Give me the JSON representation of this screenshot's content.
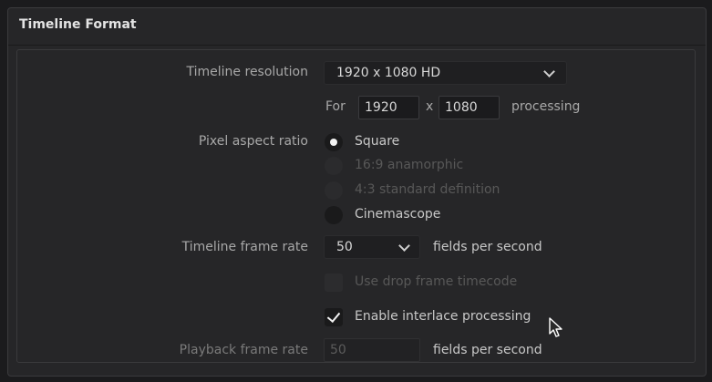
{
  "panel": {
    "title": "Timeline Format"
  },
  "resolution": {
    "label": "Timeline resolution",
    "selected": "1920 x 1080 HD",
    "for_label": "For",
    "width": "1920",
    "times": "x",
    "height": "1080",
    "processing_label": "processing"
  },
  "pixel_aspect": {
    "label": "Pixel aspect ratio",
    "options": [
      {
        "label": "Square",
        "state": "selected"
      },
      {
        "label": "16:9 anamorphic",
        "state": "disabled"
      },
      {
        "label": "4:3 standard definition",
        "state": "disabled"
      },
      {
        "label": "Cinemascope",
        "state": "enabled"
      }
    ]
  },
  "frame_rate": {
    "label": "Timeline frame rate",
    "selected": "50",
    "unit": "fields per second"
  },
  "drop_frame": {
    "label": "Use drop frame timecode",
    "checked": false,
    "disabled": true
  },
  "interlace": {
    "label": "Enable interlace processing",
    "checked": true
  },
  "playback": {
    "label": "Playback frame rate",
    "value": "50",
    "unit": "fields per second",
    "disabled": true
  },
  "icons": {
    "dropdown": "chevron-down-icon",
    "checkbox_tick": "checkmark-icon",
    "cursor": "mouse-pointer-icon"
  },
  "colors": {
    "panel_bg": "#262628",
    "field_bg": "#1b1b1d",
    "text": "#c8c8c8",
    "disabled_text": "#585858"
  }
}
